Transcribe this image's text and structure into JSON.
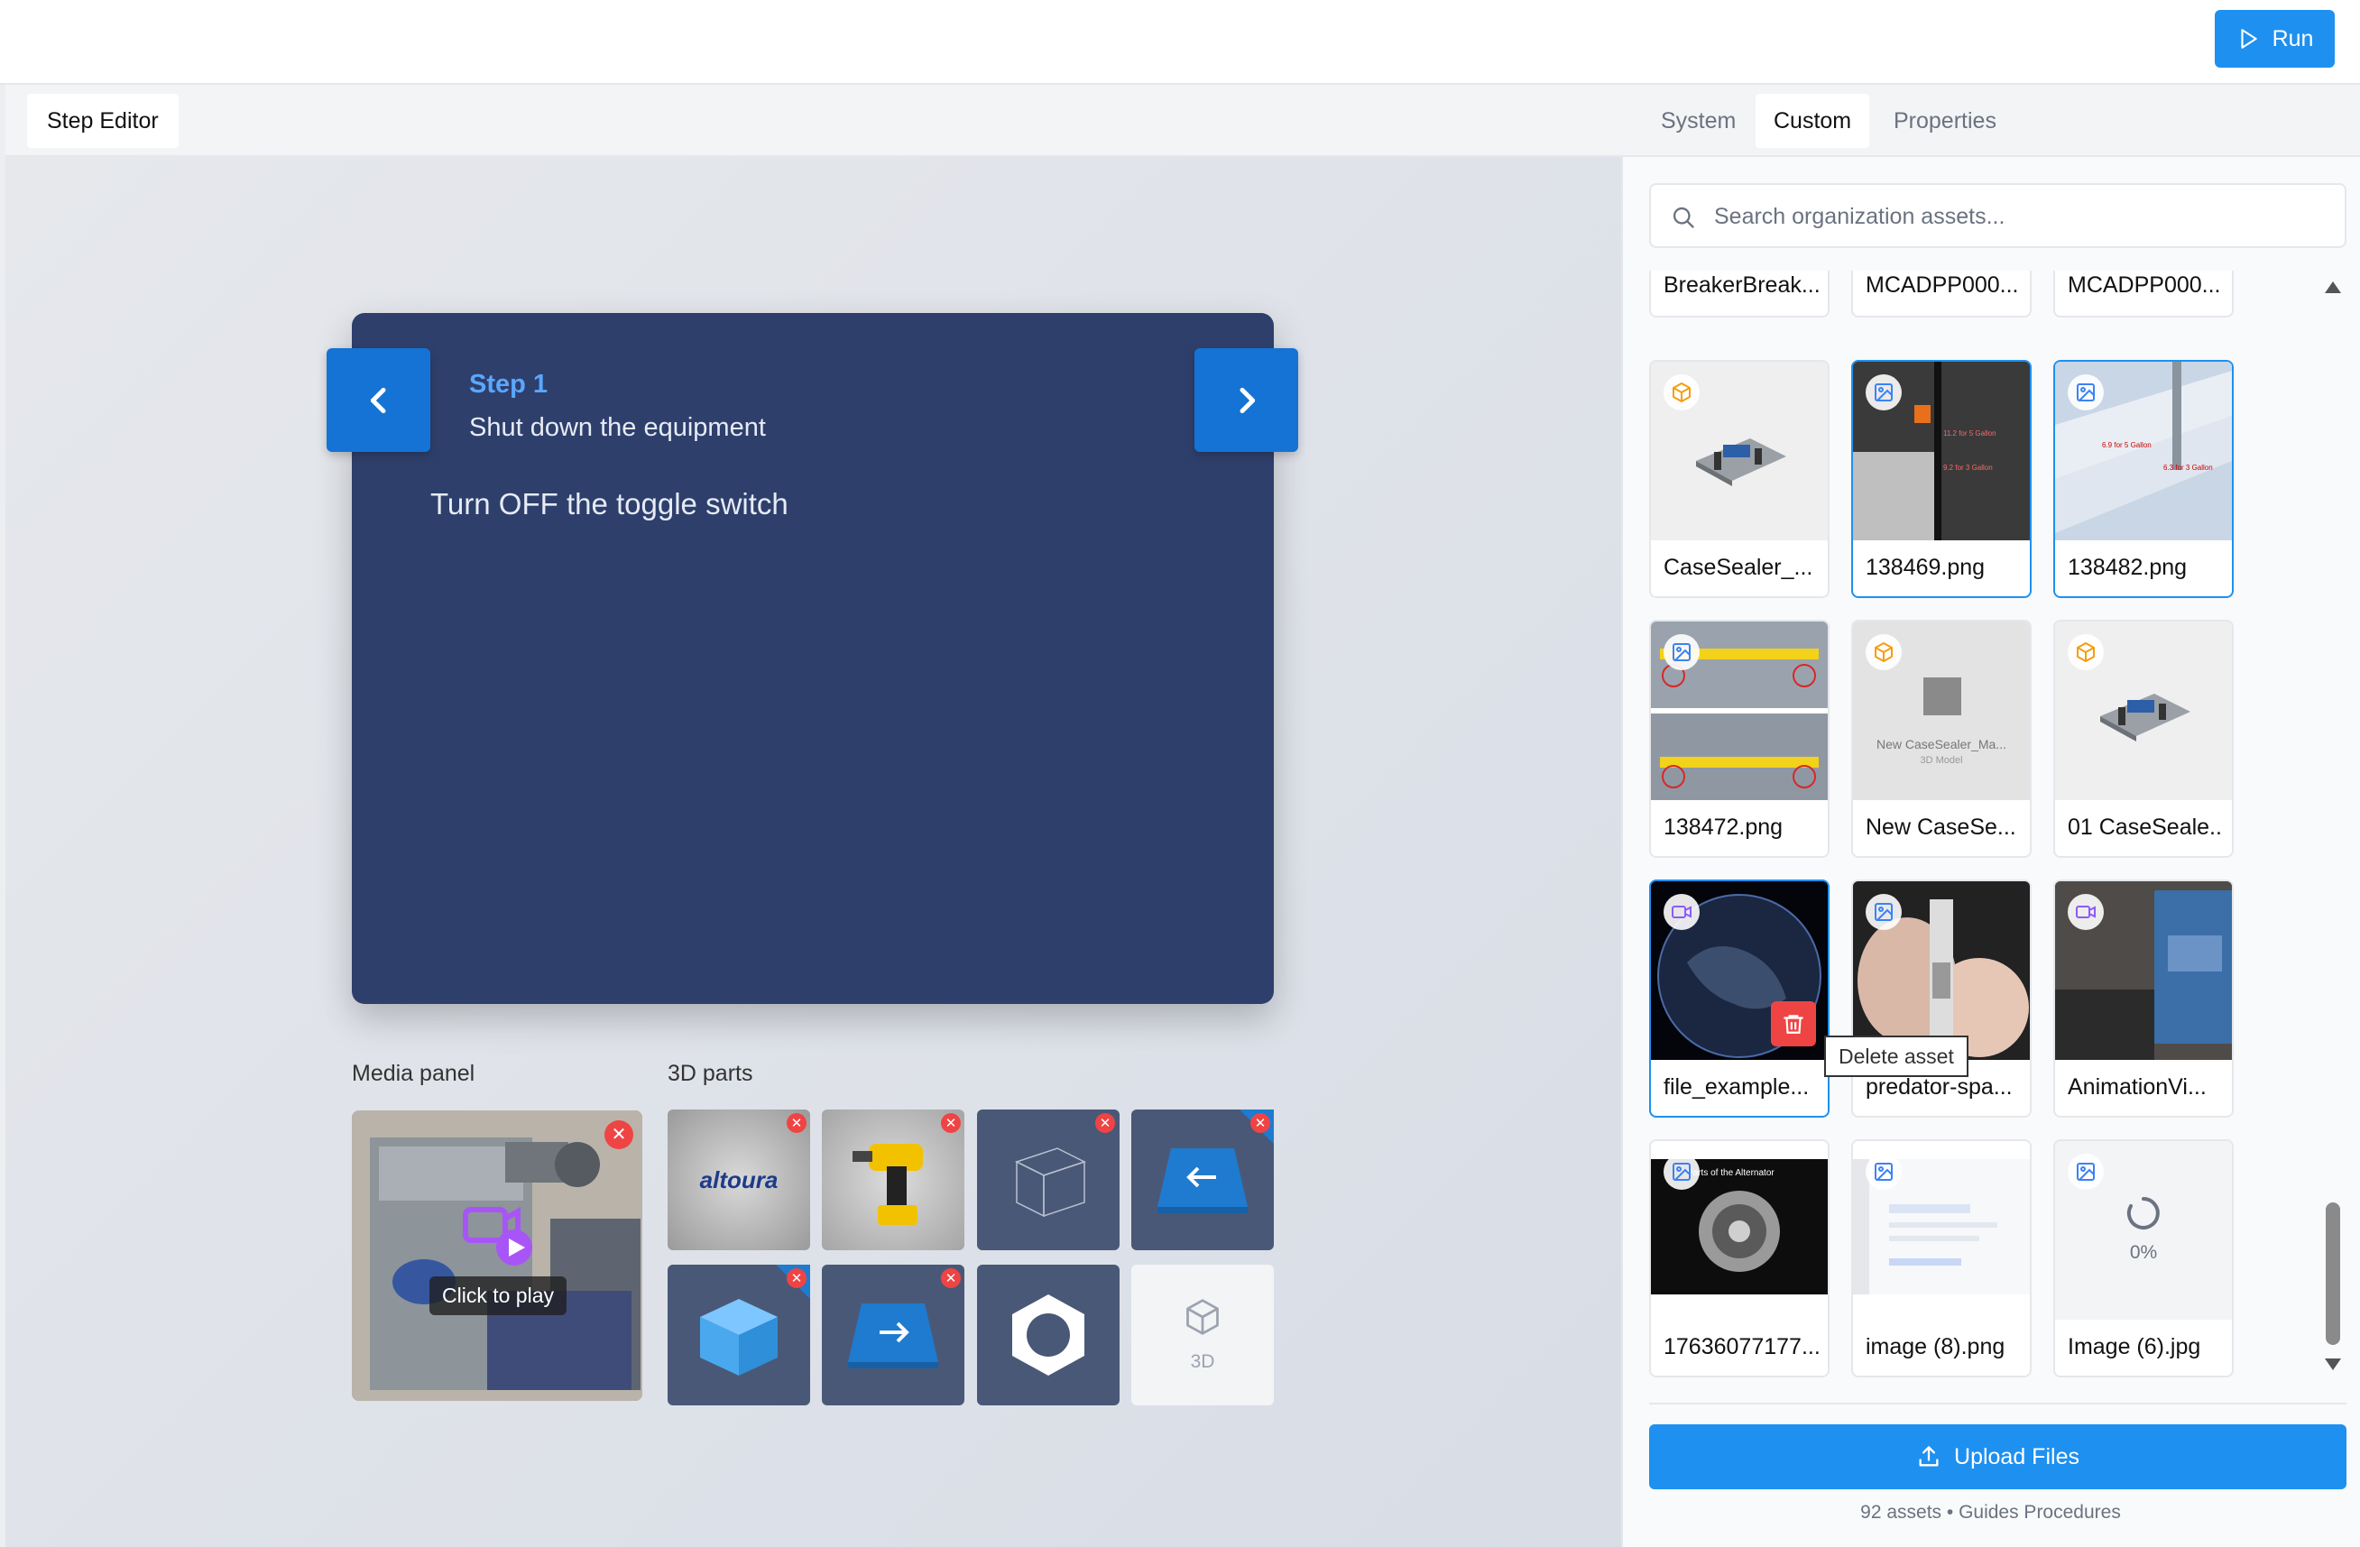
{
  "toolbar": {
    "run_label": "Run"
  },
  "editor": {
    "tab_label": "Step Editor",
    "step_number": "Step 1",
    "step_title": "Shut down the equipment",
    "step_body": "Turn OFF the toggle switch"
  },
  "media_panel": {
    "label": "Media panel",
    "play_hint": "Click to play"
  },
  "parts_panel": {
    "label": "3D parts",
    "add_label": "3D",
    "logo_text": "altoura"
  },
  "right_panel": {
    "tabs": [
      "System",
      "Custom",
      "Properties"
    ],
    "active_tab": "Custom",
    "search_placeholder": "Search organization assets...",
    "assets": [
      {
        "name": "BreakerBreak...",
        "type": "model"
      },
      {
        "name": "MCADPP000...",
        "type": "model"
      },
      {
        "name": "MCADPP000...",
        "type": "model"
      },
      {
        "name": "CaseSealer_...",
        "type": "model"
      },
      {
        "name": "138469.png",
        "type": "image"
      },
      {
        "name": "138482.png",
        "type": "image"
      },
      {
        "name": "138472.png",
        "type": "image"
      },
      {
        "name": "New CaseSe...",
        "type": "model"
      },
      {
        "name": "01 CaseSeale...",
        "type": "model"
      },
      {
        "name": "file_example...",
        "type": "video"
      },
      {
        "name": "predator-spa...",
        "type": "image"
      },
      {
        "name": "AnimationVi...",
        "type": "video"
      },
      {
        "name": "17636077177...",
        "type": "image"
      },
      {
        "name": "image (8).png",
        "type": "image"
      },
      {
        "name": "Image (6).jpg",
        "type": "image"
      }
    ],
    "thumb_texts": {
      "new_casesealer_title": "New CaseSealer_Ma...",
      "new_casesealer_sub": "3D Model",
      "alternator_title": "Parts of the Alternator",
      "upload_progress": "0%",
      "gallon_a": "11.2 for 5 Gallon",
      "gallon_b": "9.2 for 3 Gallon",
      "gallon_c": "6.9 for 5 Gallon",
      "gallon_d": "6.3 for 3 Gallon"
    },
    "delete_tooltip": "Delete asset",
    "upload_label": "Upload Files",
    "footer": "92 assets • Guides Procedures"
  }
}
